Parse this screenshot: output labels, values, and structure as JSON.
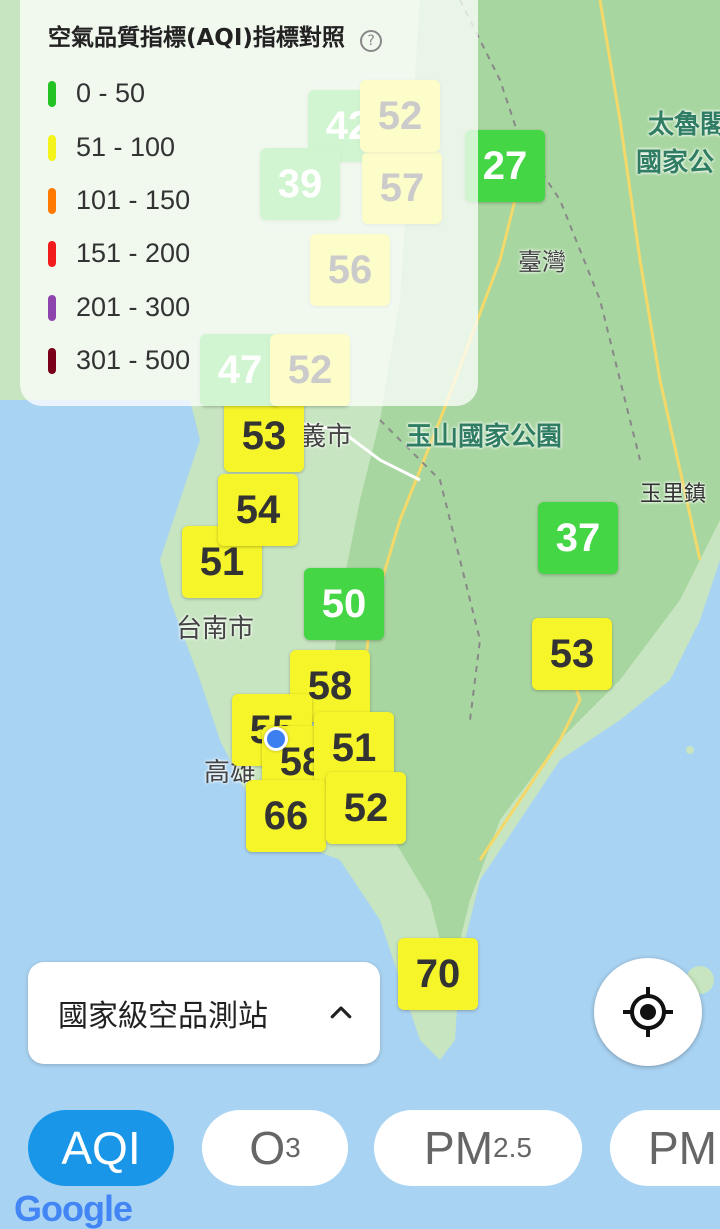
{
  "legend": {
    "title": "空氣品質指標(AQI)指標對照",
    "help_icon": "?",
    "items": [
      {
        "label": "0 - 50",
        "color": "#22c322"
      },
      {
        "label": "51 - 100",
        "color": "#f4f41c"
      },
      {
        "label": "101 - 150",
        "color": "#ff7a00"
      },
      {
        "label": "151 - 200",
        "color": "#f21b1b"
      },
      {
        "label": "201 - 300",
        "color": "#8e44ad"
      },
      {
        "label": "301 - 500",
        "color": "#7a0019"
      }
    ]
  },
  "map_labels": {
    "taroko": "太魯閣",
    "taroko2": "國家公",
    "taiwan": "臺灣",
    "yushan": "玉山國家公園",
    "chiayi": "義市",
    "yuli": "玉里鎮",
    "tainan": "台南市",
    "kaohsiung": "高雄"
  },
  "markers": [
    {
      "value": "27",
      "level": "good"
    },
    {
      "value": "37",
      "level": "good"
    },
    {
      "value": "50",
      "level": "good"
    },
    {
      "value": "53",
      "level": "moderate"
    },
    {
      "value": "51",
      "level": "moderate"
    },
    {
      "value": "53",
      "level": "moderate"
    },
    {
      "value": "54",
      "level": "moderate"
    },
    {
      "value": "58",
      "level": "moderate"
    },
    {
      "value": "55",
      "level": "moderate"
    },
    {
      "value": "58",
      "level": "moderate"
    },
    {
      "value": "51",
      "level": "moderate"
    },
    {
      "value": "66",
      "level": "moderate"
    },
    {
      "value": "52",
      "level": "moderate"
    },
    {
      "value": "70",
      "level": "moderate"
    },
    {
      "value": "42",
      "level": "good"
    },
    {
      "value": "39",
      "level": "good"
    },
    {
      "value": "57",
      "level": "moderate"
    },
    {
      "value": "56",
      "level": "moderate"
    },
    {
      "value": "47",
      "level": "good"
    },
    {
      "value": "52",
      "level": "moderate"
    },
    {
      "value": "52",
      "level": "moderate"
    }
  ],
  "station_select": {
    "label": "國家級空品測站"
  },
  "tabs": [
    {
      "label": "AQI",
      "active": true
    },
    {
      "label": "O",
      "sub": "3"
    },
    {
      "label": "PM",
      "sub": "2.5"
    },
    {
      "label": "PM"
    }
  ],
  "google_logo": "Google"
}
